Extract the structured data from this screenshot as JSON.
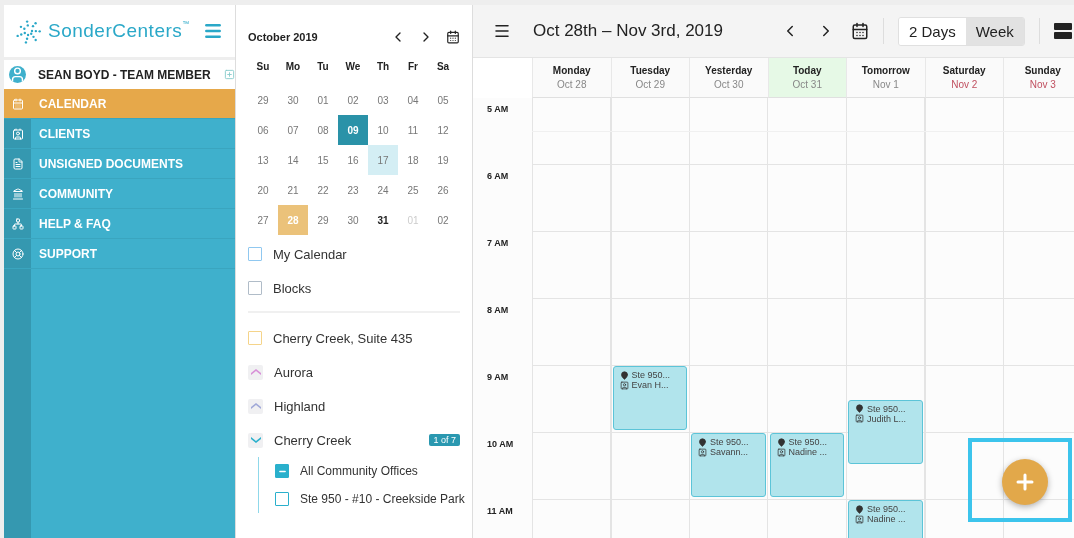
{
  "brand": {
    "name": "SonderCenters",
    "tm": "™"
  },
  "user": {
    "name": "SEAN BOYD - TEAM MEMBER"
  },
  "nav": [
    {
      "label": "CALENDAR",
      "selected": true
    },
    {
      "label": "CLIENTS",
      "selected": false
    },
    {
      "label": "UNSIGNED DOCUMENTS",
      "selected": false
    },
    {
      "label": "COMMUNITY",
      "selected": false
    },
    {
      "label": "HELP & FAQ",
      "selected": false
    },
    {
      "label": "SUPPORT",
      "selected": false
    }
  ],
  "mini_calendar": {
    "title": "October 2019",
    "weekdays": [
      "Su",
      "Mo",
      "Tu",
      "We",
      "Th",
      "Fr",
      "Sa"
    ],
    "weeks": [
      [
        {
          "label": "29",
          "kind": "normal"
        },
        {
          "label": "30",
          "kind": "normal"
        },
        {
          "label": "01",
          "kind": "normal"
        },
        {
          "label": "02",
          "kind": "normal"
        },
        {
          "label": "03",
          "kind": "normal"
        },
        {
          "label": "04",
          "kind": "normal"
        },
        {
          "label": "05",
          "kind": "normal"
        }
      ],
      [
        {
          "label": "06",
          "kind": "normal"
        },
        {
          "label": "07",
          "kind": "normal"
        },
        {
          "label": "08",
          "kind": "normal"
        },
        {
          "label": "09",
          "kind": "selected"
        },
        {
          "label": "10",
          "kind": "normal"
        },
        {
          "label": "11",
          "kind": "normal"
        },
        {
          "label": "12",
          "kind": "normal"
        }
      ],
      [
        {
          "label": "13",
          "kind": "normal"
        },
        {
          "label": "14",
          "kind": "normal"
        },
        {
          "label": "15",
          "kind": "normal"
        },
        {
          "label": "16",
          "kind": "normal"
        },
        {
          "label": "17",
          "kind": "highlight"
        },
        {
          "label": "18",
          "kind": "normal"
        },
        {
          "label": "19",
          "kind": "normal"
        }
      ],
      [
        {
          "label": "20",
          "kind": "normal"
        },
        {
          "label": "21",
          "kind": "normal"
        },
        {
          "label": "22",
          "kind": "normal"
        },
        {
          "label": "23",
          "kind": "normal"
        },
        {
          "label": "24",
          "kind": "normal"
        },
        {
          "label": "25",
          "kind": "normal"
        },
        {
          "label": "26",
          "kind": "normal"
        }
      ],
      [
        {
          "label": "27",
          "kind": "normal"
        },
        {
          "label": "28",
          "kind": "week"
        },
        {
          "label": "29",
          "kind": "normal"
        },
        {
          "label": "30",
          "kind": "normal"
        },
        {
          "label": "31",
          "kind": "today"
        },
        {
          "label": "01",
          "kind": "muted"
        },
        {
          "label": "02",
          "kind": "normal"
        }
      ]
    ]
  },
  "calendars": [
    {
      "label": "My Calendar",
      "kind": "checkbox",
      "checked": false,
      "color": "#90c8f0"
    },
    {
      "label": "Blocks",
      "kind": "checkbox",
      "checked": false,
      "color": "#b0bcc8"
    }
  ],
  "offices": [
    {
      "label": "Cherry Creek, Suite 435",
      "kind": "checkbox",
      "checked": false,
      "color": "#f5d48a"
    },
    {
      "label": "Aurora",
      "kind": "group",
      "expanded": false,
      "color": "#d890d8"
    },
    {
      "label": "Highland",
      "kind": "group",
      "expanded": false,
      "color": "#a0a8d8"
    },
    {
      "label": "Cherry Creek",
      "kind": "group",
      "expanded": true,
      "color": "#2ab0cc",
      "badge": "1 of 7",
      "children": [
        {
          "label": "All Community Offices",
          "indeterminate": true
        },
        {
          "label": "Ste 950 - #10 - Creekside Park",
          "checked": false
        }
      ]
    }
  ],
  "toolbar": {
    "title": "Oct 28th – Nov 3rd, 2019",
    "views": [
      {
        "label": "2 Days",
        "selected": false
      },
      {
        "label": "Week",
        "selected": true
      }
    ]
  },
  "days": [
    {
      "name": "Monday",
      "date": "Oct 28",
      "today": false,
      "weekend": false
    },
    {
      "name": "Tuesday",
      "date": "Oct 29",
      "today": false,
      "weekend": false
    },
    {
      "name": "Yesterday",
      "date": "Oct 30",
      "today": false,
      "weekend": false
    },
    {
      "name": "Today",
      "date": "Oct 31",
      "today": true,
      "weekend": false
    },
    {
      "name": "Tomorrow",
      "date": "Nov 1",
      "today": false,
      "weekend": false
    },
    {
      "name": "Saturday",
      "date": "Nov 2",
      "today": false,
      "weekend": true
    },
    {
      "name": "Sunday",
      "date": "Nov 3",
      "today": false,
      "weekend": true
    }
  ],
  "hours": [
    {
      "label": "5 AM"
    },
    {
      "label": "6 AM"
    },
    {
      "label": "7 AM"
    },
    {
      "label": "8 AM"
    },
    {
      "label": "9 AM",
      "halves": [
        {
          "cells": [
            {
              "kind": "empty"
            },
            {
              "kind": "event",
              "location": "Ste 950...",
              "client": "Evan H..."
            },
            {
              "kind": "empty"
            },
            {
              "kind": "empty"
            },
            {
              "kind": "empty"
            },
            {
              "kind": "empty"
            },
            {
              "kind": "empty"
            }
          ]
        },
        {
          "cells": [
            {
              "kind": "empty"
            },
            {
              "kind": "empty"
            },
            {
              "kind": "empty"
            },
            {
              "kind": "empty"
            },
            {
              "kind": "event",
              "location": "Ste 950...",
              "client": "Judith L..."
            },
            {
              "kind": "empty"
            },
            {
              "kind": "empty"
            }
          ]
        }
      ]
    },
    {
      "label": "10 AM",
      "halves": [
        {
          "cells": [
            {
              "kind": "empty"
            },
            {
              "kind": "empty"
            },
            {
              "kind": "event",
              "location": "Ste 950...",
              "client": "Savann..."
            },
            {
              "kind": "event",
              "location": "Ste 950...",
              "client": "Nadine ..."
            },
            {
              "kind": "empty"
            },
            {
              "kind": "empty"
            },
            {
              "kind": "empty"
            }
          ]
        }
      ]
    },
    {
      "label": "11 AM",
      "halves": [
        {
          "cells": [
            {
              "kind": "empty"
            },
            {
              "kind": "empty"
            },
            {
              "kind": "empty"
            },
            {
              "kind": "empty"
            },
            {
              "kind": "event",
              "location": "Ste 950...",
              "client": "Nadine ..."
            },
            {
              "kind": "empty"
            },
            {
              "kind": "empty"
            }
          ]
        }
      ]
    }
  ]
}
